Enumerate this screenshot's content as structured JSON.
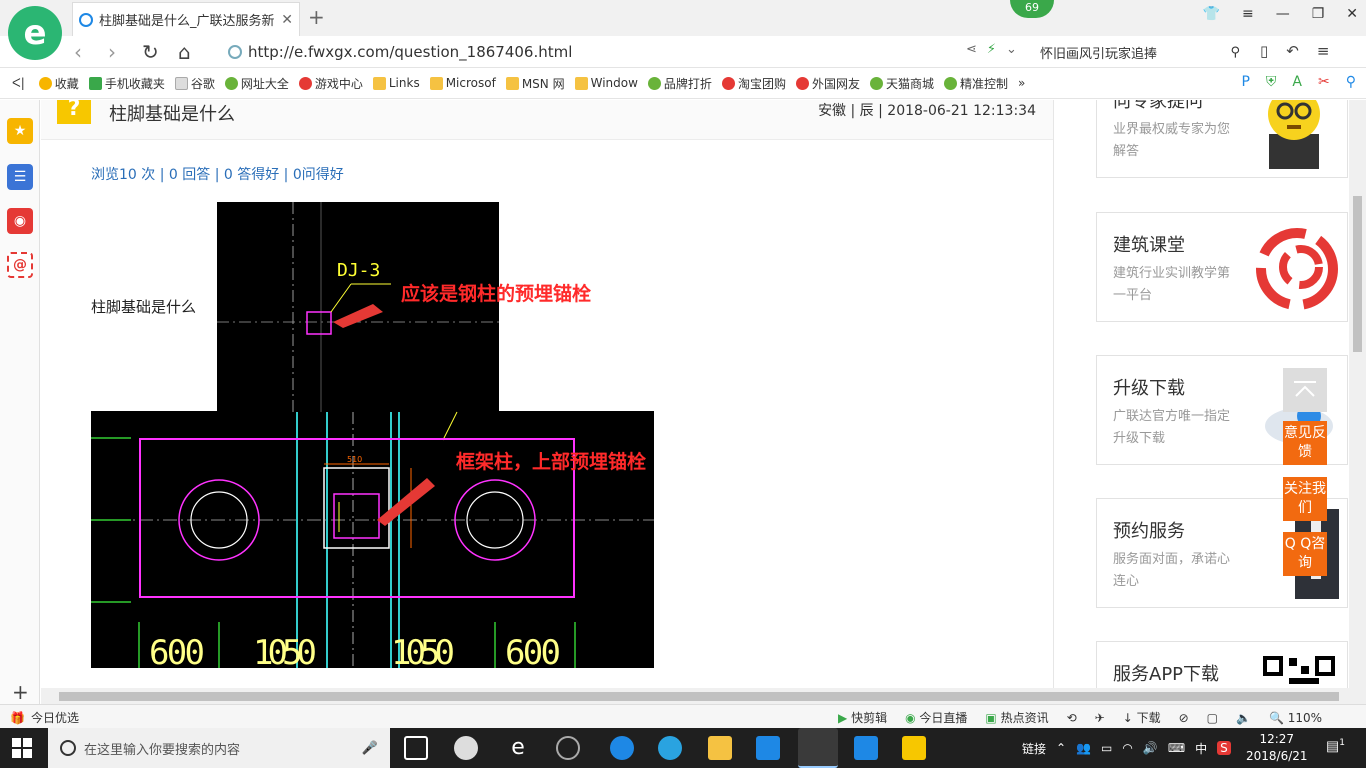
{
  "browser": {
    "tab_title": "柱脚基础是什么_广联达服务新干",
    "badge_count": "69",
    "url": "http://e.fwxgx.com/question_1867406.html",
    "search_text": "怀旧画风引玩家追捧",
    "zoom": "110%"
  },
  "bookmarks": [
    {
      "label": "收藏",
      "icon": "star-icon"
    },
    {
      "label": "手机收藏夹",
      "icon": "phone-icon"
    },
    {
      "label": "谷歌",
      "icon": "page-icon"
    },
    {
      "label": "网址大全",
      "icon": "nav-icon"
    },
    {
      "label": "游戏中心",
      "icon": "game-icon"
    },
    {
      "label": "Links",
      "icon": "folder-icon"
    },
    {
      "label": "Microsof",
      "icon": "folder-icon"
    },
    {
      "label": "MSN 网",
      "icon": "folder-icon"
    },
    {
      "label": "Window",
      "icon": "folder-icon"
    },
    {
      "label": "品牌打折",
      "icon": "leaf-icon"
    },
    {
      "label": "淘宝团购",
      "icon": "taobao-icon"
    },
    {
      "label": "外国网友",
      "icon": "bookmark-icon"
    },
    {
      "label": "天猫商城",
      "icon": "leaf-icon"
    },
    {
      "label": "精准控制",
      "icon": "chat-icon"
    }
  ],
  "question": {
    "title": "柱脚基础是什么",
    "meta": "安徽 | 辰 | 2018-06-21 12:13:34",
    "stats": "浏览10 次 | 0 回答 | 0 答得好 | 0问得好",
    "body": "柱脚基础是什么"
  },
  "cad": {
    "label_dj": "DJ-3",
    "annotation_1": "应该是钢柱的预埋锚栓",
    "annotation_2": "框架柱，上部预埋锚栓",
    "dim_small": "510",
    "dims": [
      "600",
      "1050",
      "1050",
      "600"
    ]
  },
  "cards": [
    {
      "title": "向专家提问",
      "desc": "业界最权威专家为您解答"
    },
    {
      "title": "建筑课堂",
      "desc": "建筑行业实训教学第一平台"
    },
    {
      "title": "升级下载",
      "desc": "广联达官方唯一指定升级下载"
    },
    {
      "title": "预约服务",
      "desc": "服务面对面，承诺心连心"
    },
    {
      "title": "服务APP下载",
      "desc": ""
    }
  ],
  "float_buttons": [
    "意见反馈",
    "关注我们",
    "Q Q咨询"
  ],
  "statusbar": {
    "left": "今日优选",
    "items": [
      "快剪辑",
      "今日直播",
      "热点资讯",
      "下载"
    ]
  },
  "taskbar": {
    "search_placeholder": "在这里输入你要搜索的内容",
    "tray_label": "链接",
    "ime": "中",
    "time": "12:27",
    "date": "2018/6/21",
    "notification_count": "1"
  }
}
